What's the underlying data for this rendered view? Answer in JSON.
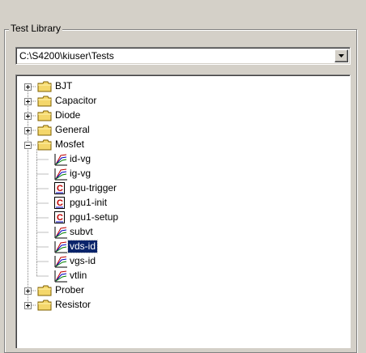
{
  "group": {
    "title": "Test Library"
  },
  "path_combo": {
    "value": "C:\\S4200\\kiuser\\Tests"
  },
  "tree": {
    "folders_top": [
      {
        "label": "BJT"
      },
      {
        "label": "Capacitor"
      },
      {
        "label": "Diode"
      },
      {
        "label": "General"
      }
    ],
    "expanded_folder": {
      "label": "Mosfet"
    },
    "children": [
      {
        "label": "id-vg",
        "icon": "ulib-test-icon"
      },
      {
        "label": "ig-vg",
        "icon": "ulib-test-icon"
      },
      {
        "label": "pgu-trigger",
        "icon": "c-module-icon"
      },
      {
        "label": "pgu1-init",
        "icon": "c-module-icon"
      },
      {
        "label": "pgu1-setup",
        "icon": "c-module-icon"
      },
      {
        "label": "subvt",
        "icon": "ulib-test-icon"
      },
      {
        "label": "vds-id",
        "icon": "ulib-test-icon",
        "selected": true
      },
      {
        "label": "vgs-id",
        "icon": "ulib-test-icon"
      },
      {
        "label": "vtlin",
        "icon": "ulib-test-icon"
      }
    ],
    "folders_bottom": [
      {
        "label": "Prober"
      },
      {
        "label": "Resistor"
      }
    ]
  },
  "colors": {
    "selection": "#0a246a",
    "folder": "#f4d76b",
    "chrome": "#d4d0c8"
  }
}
